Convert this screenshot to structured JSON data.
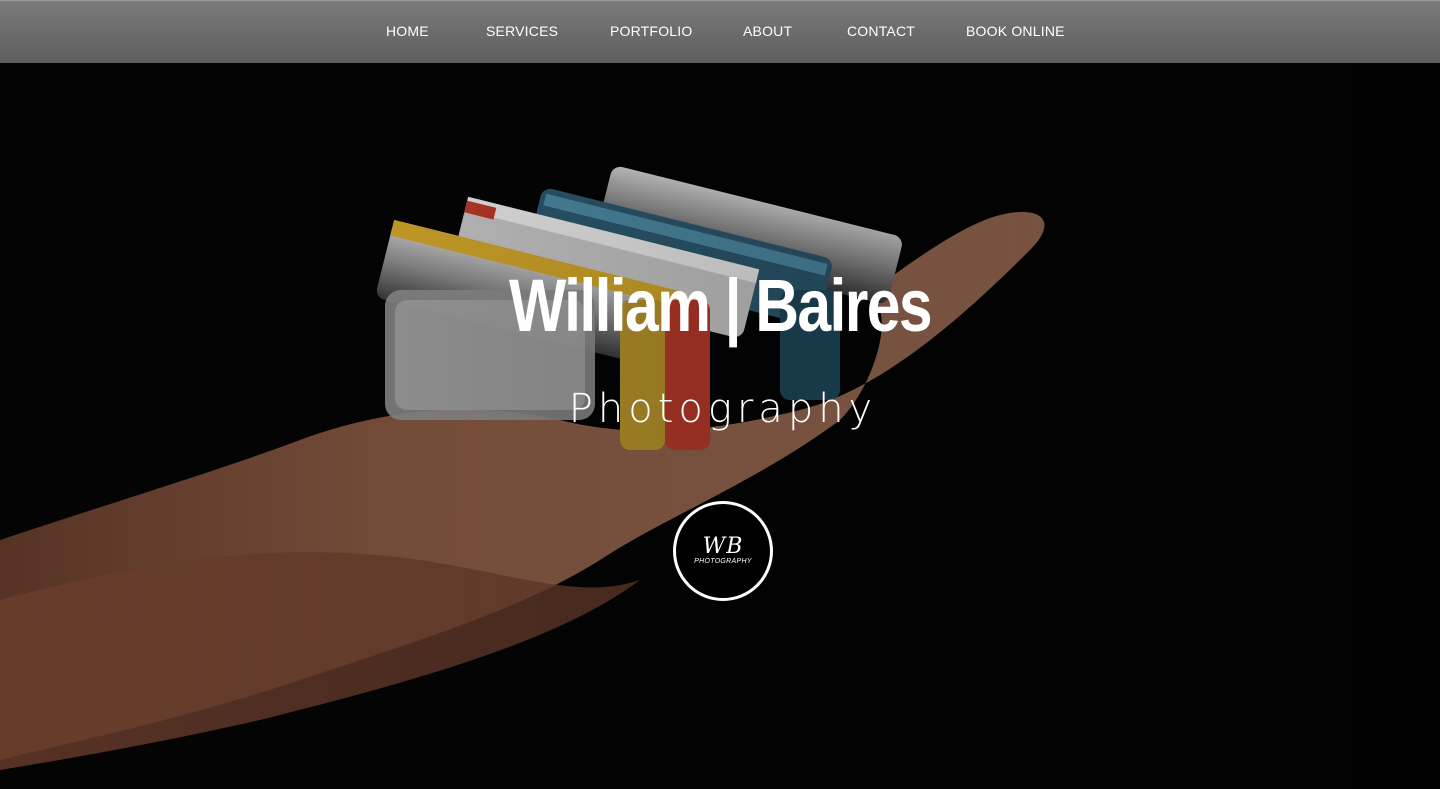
{
  "nav": {
    "items": [
      {
        "label": "HOME"
      },
      {
        "label": "SERVICES"
      },
      {
        "label": "PORTFOLIO"
      },
      {
        "label": "ABOUT"
      },
      {
        "label": "CONTACT"
      },
      {
        "label": "BOOK ONLINE"
      }
    ]
  },
  "hero": {
    "title": "William | Baires",
    "subtitle": "Photography",
    "background_image": "hand-holding-harmonicas"
  },
  "logo": {
    "mark": "WB",
    "sub": "PHOTOGRAPHY"
  },
  "colors": {
    "nav_background": "#6a6a6a",
    "nav_text": "#ffffff",
    "hero_background": "#030303",
    "hero_text": "#ffffff"
  }
}
